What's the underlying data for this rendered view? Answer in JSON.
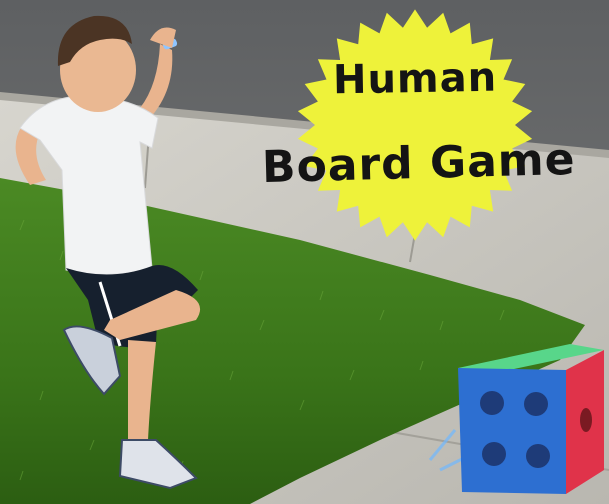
{
  "title": {
    "line1": "Human",
    "line2": "Board Game"
  },
  "colors": {
    "asphalt": "#6b6d6e",
    "sidewalk": "#c9c7c0",
    "grass": "#3f7a1f",
    "starburst": "#eef23a",
    "dice_blue": "#2d6fd1",
    "dice_red": "#e0334a",
    "dice_green": "#58d68a"
  },
  "icons": {
    "starburst": "yellow-starburst-badge",
    "dice": "large-foam-dice"
  }
}
